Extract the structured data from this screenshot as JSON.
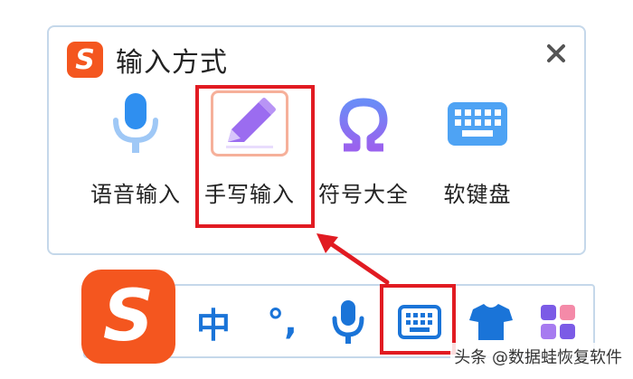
{
  "popup": {
    "title": "输入方式",
    "logo_letter": "S",
    "tools": [
      {
        "label": "语音输入",
        "icon": "microphone-icon"
      },
      {
        "label": "手写输入",
        "icon": "pencil-icon",
        "selected": true
      },
      {
        "label": "符号大全",
        "icon": "omega-icon"
      },
      {
        "label": "软键盘",
        "icon": "keyboard-icon"
      }
    ]
  },
  "toolbar": {
    "logo_letter": "S",
    "chinese_mode": "中",
    "punctuation": "°,",
    "items": [
      "microphone-icon",
      "keyboard-icon",
      "tshirt-icon",
      "apps-grid-icon"
    ]
  },
  "watermark": "头条 @数据蛙恢复软件",
  "colors": {
    "brand_orange": "#f4561f",
    "accent_blue": "#1a74d8",
    "highlight_red": "#e11b22",
    "pencil_purple": "#9b6cf0"
  }
}
